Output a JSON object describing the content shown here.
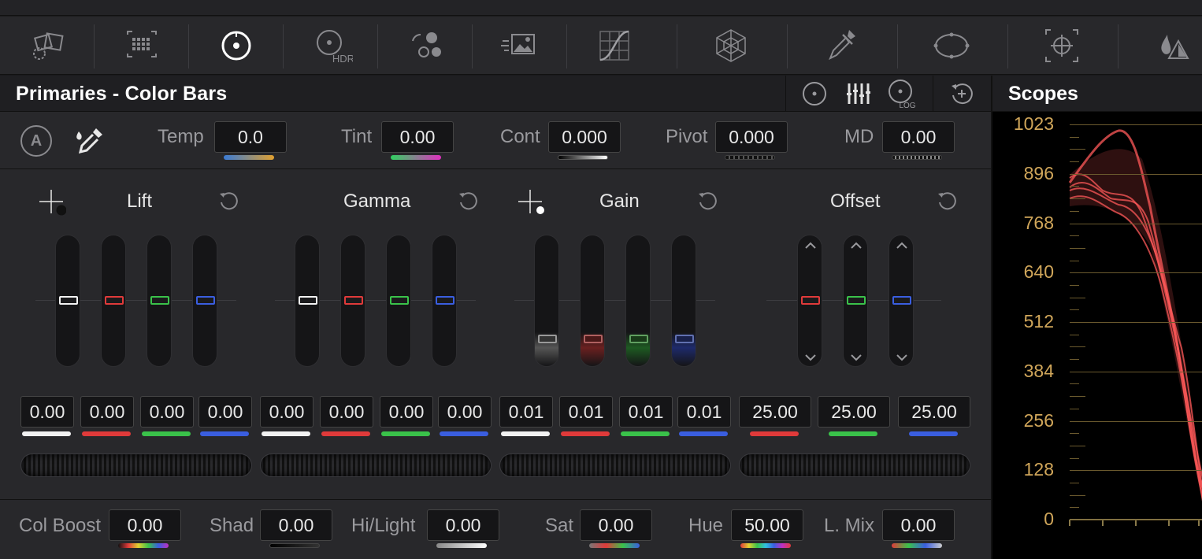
{
  "toolbar": {
    "tools": [
      {
        "name": "camera-raw-icon"
      },
      {
        "name": "color-match-icon"
      },
      {
        "name": "primaries-wheels-icon",
        "active": true
      },
      {
        "name": "hdr-wheels-icon",
        "label": "HDR"
      },
      {
        "name": "rgb-mixer-icon"
      },
      {
        "name": "motion-effects-icon"
      },
      {
        "name": "curves-icon"
      },
      {
        "name": "color-warper-icon"
      },
      {
        "name": "qualifier-icon"
      },
      {
        "name": "window-icon"
      },
      {
        "name": "tracker-icon"
      },
      {
        "name": "blur-icon"
      }
    ]
  },
  "panel": {
    "title": "Primaries - Color Bars",
    "header_buttons": [
      "wheels-mode-icon",
      "bars-mode-icon",
      "log-mode-icon",
      "reset-all-icon"
    ],
    "log_label": "LOG"
  },
  "adjust": {
    "auto_label": "A",
    "temp": {
      "label": "Temp",
      "value": "0.0"
    },
    "tint": {
      "label": "Tint",
      "value": "0.00"
    },
    "cont": {
      "label": "Cont",
      "value": "0.000"
    },
    "pivot": {
      "label": "Pivot",
      "value": "0.000"
    },
    "md": {
      "label": "MD",
      "value": "0.00"
    }
  },
  "wheels": {
    "lift": {
      "title": "Lift",
      "values": [
        "0.00",
        "0.00",
        "0.00",
        "0.00"
      ]
    },
    "gamma": {
      "title": "Gamma",
      "values": [
        "0.00",
        "0.00",
        "0.00",
        "0.00"
      ]
    },
    "gain": {
      "title": "Gain",
      "values": [
        "0.01",
        "0.01",
        "0.01",
        "0.01"
      ]
    },
    "offset": {
      "title": "Offset",
      "values": [
        "25.00",
        "25.00",
        "25.00"
      ]
    }
  },
  "bottom": {
    "col_boost": {
      "label": "Col Boost",
      "value": "0.00"
    },
    "shad": {
      "label": "Shad",
      "value": "0.00"
    },
    "hilight": {
      "label": "Hi/Light",
      "value": "0.00"
    },
    "sat": {
      "label": "Sat",
      "value": "0.00"
    },
    "hue": {
      "label": "Hue",
      "value": "50.00"
    },
    "lmix": {
      "label": "L. Mix",
      "value": "0.00"
    }
  },
  "scopes": {
    "title": "Scopes",
    "scale": [
      "1023",
      "896",
      "768",
      "640",
      "512",
      "384",
      "256",
      "128",
      "0"
    ]
  },
  "colors": {
    "white": "#f2f2f2",
    "red": "#e03a3a",
    "green": "#3ac24a",
    "blue": "#3a5ee0",
    "scope_label": "#d0a65a",
    "waveform": "#ff5a5a"
  }
}
